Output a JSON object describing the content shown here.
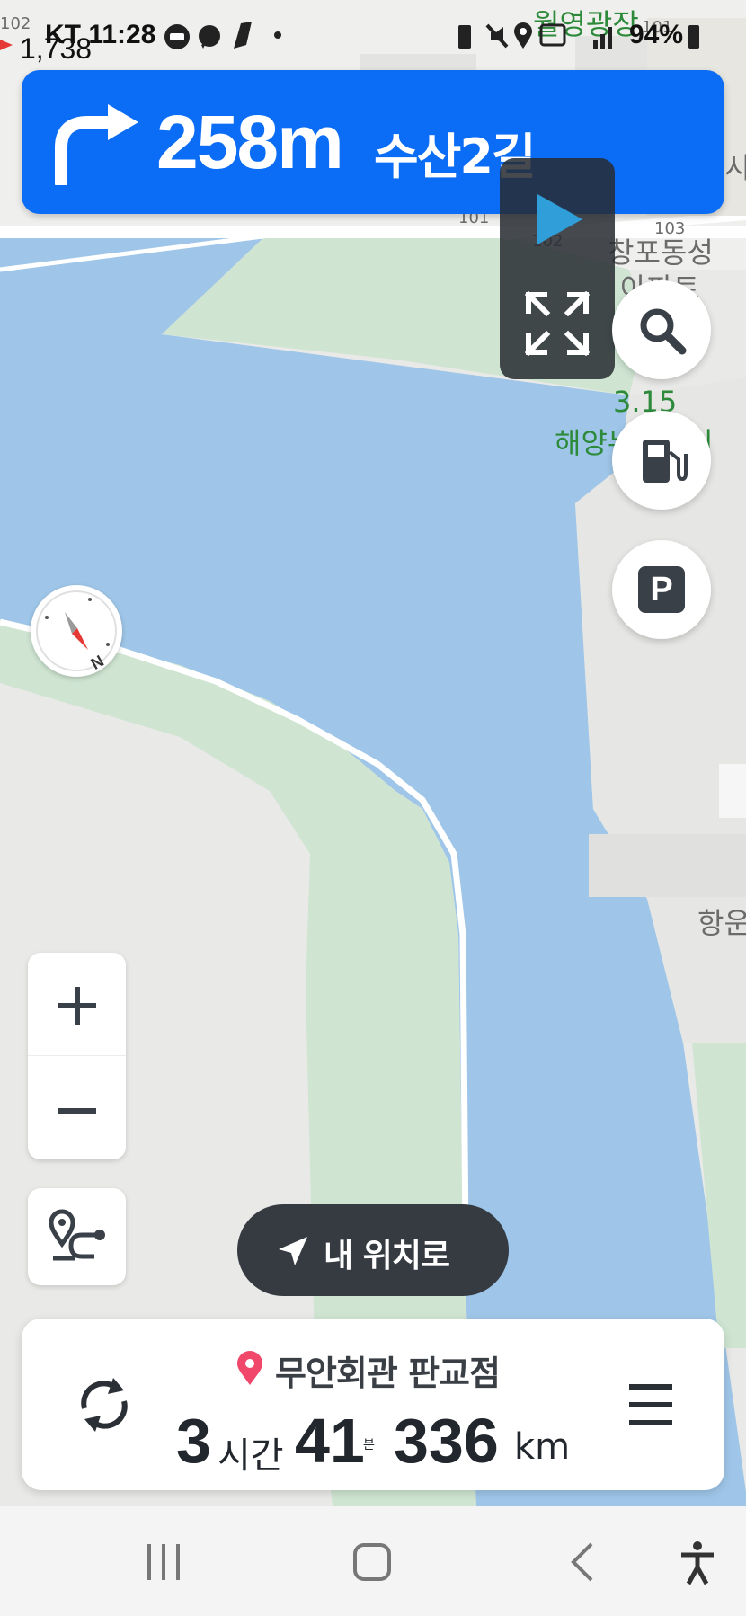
{
  "status_bar": {
    "badge_count": "1,738",
    "carrier_time": "KT 11:28",
    "battery": "94%"
  },
  "map": {
    "labels": {
      "plaza": "월영광장",
      "neighborhood_1": "창포동성",
      "neighborhood_2": "아파트",
      "park_num": "3.15",
      "park_name": "해양누리공원",
      "port": "항운",
      "building_101a": "101",
      "building_101b": "101",
      "building_102a": "102",
      "building_102b": "102",
      "building_103": "103",
      "edge_char": "시"
    }
  },
  "turn_banner": {
    "direction_icon": "turn-right-arrow-icon",
    "distance": "258m",
    "road": "수산2길"
  },
  "controls": {
    "search_icon": "search-icon",
    "fuel_icon": "gas-station-icon",
    "parking_label": "P",
    "compass_label": "N",
    "zoom_in_label": "+",
    "zoom_out_label": "−",
    "my_location_label": "내 위치로"
  },
  "destination": {
    "name": "무안회관 판교점",
    "hours": "3",
    "hours_unit": "시간",
    "minutes": "41",
    "minutes_unit": "분",
    "distance": "336",
    "distance_unit": "km"
  },
  "colors": {
    "banner_blue": "#0b6cf5",
    "water": "#9fc6e8",
    "park": "#cfe5d2",
    "land": "#e9e9e7",
    "pin_red": "#f0476a"
  }
}
